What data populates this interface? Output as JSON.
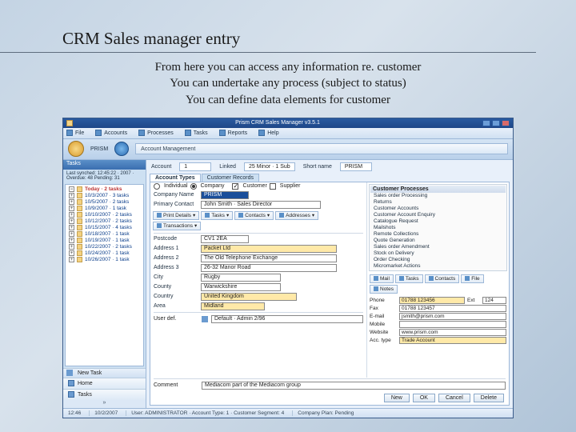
{
  "slide": {
    "title": "CRM Sales manager entry",
    "bullets": [
      "From here you can access any information re. customer",
      "You can undertake any process (subject to status)",
      "You can define data elements for customer"
    ]
  },
  "titlebar": "Prism CRM Sales Manager  v3.5.1",
  "menubar": [
    "File",
    "Accounts",
    "Processes",
    "Tasks",
    "Reports",
    "Help"
  ],
  "ribbon": {
    "brand": "PRISM",
    "crumb": "Account Management"
  },
  "sidebar": {
    "header": "Tasks",
    "subtitle": "Last synched: 12:45:22 · 2007  ·  Overdue: 48  Pending: 31",
    "root": "Today · 2 tasks",
    "dates": [
      "10/3/2007 · 3 tasks",
      "10/5/2007 · 2 tasks",
      "10/9/2007 · 1 task",
      "10/10/2007 · 2 tasks",
      "10/12/2007 · 2 tasks",
      "10/15/2007 · 4 tasks",
      "10/18/2007 · 1 task",
      "10/19/2007 · 1 task",
      "10/22/2007 · 2 tasks",
      "10/24/2007 · 1 task",
      "10/26/2007 · 1 task"
    ],
    "foot_label": "New Task",
    "nav": [
      "Home",
      "Tasks"
    ],
    "chev": "»"
  },
  "ids": {
    "acc_lab": "Account",
    "acc_val": "1",
    "linked_lab": "Linked",
    "linked_val": "25 Minor · 1 Sub",
    "short_lab": "Short name",
    "short_val": "PRISM"
  },
  "tabs": [
    "Account Types",
    "Customer Records"
  ],
  "types": {
    "individual_lab": "Individual",
    "company_lab": "Company",
    "customer_lab": "Customer",
    "supplier_lab": "Supplier",
    "contact_lab": "Primary Contact",
    "contact_val": "John Smith · Sales Director",
    "name_lab": "Company Name",
    "name_val": "PRISM"
  },
  "toolbar": [
    "Print Details",
    "Tasks",
    "Contacts",
    "Addresses",
    "Transactions"
  ],
  "toolbar_r": [
    "Mail",
    "Tasks",
    "Contacts",
    "File",
    "Notes"
  ],
  "details": {
    "postcode_lab": "Postcode",
    "postcode_val": "CV1 2EA",
    "addr1_lab": "Address 1",
    "addr1_val": "Packet Ltd",
    "addr2_lab": "Address 2",
    "addr2_val": "The Old Telephone Exchange",
    "addr3_lab": "Address 3",
    "addr3_val": "26-32 Manor Road",
    "city_lab": "City",
    "city_val": "Rugby",
    "county_lab": "County",
    "county_val": "Warwickshire",
    "country_lab": "Country",
    "country_val": "United Kingdom",
    "area_lab": "Area",
    "area_val": "Midland"
  },
  "proc": {
    "header": "Customer Processes",
    "items": [
      "Sales order Processing",
      "Returns",
      "Customer Accounts",
      "Customer Account Enquiry",
      "Catalogue Request",
      "Mailshots",
      "Remote Collections",
      "Quote Generation",
      "Sales order Amendment",
      "Stock on Delivery",
      "Order Checking",
      "Micromarket Actions"
    ]
  },
  "rfields": {
    "phone_lab": "Phone",
    "phone_val": "01788 123456",
    "ext_lab": "Ext",
    "ext_val": "124",
    "fax_lab": "Fax",
    "fax_val": "01788 123457",
    "email_lab": "E-mail",
    "email_val": "jsmith@prism.com",
    "mobile_lab": "Mobile",
    "mobile_val": "",
    "web_lab": "Website",
    "web_val": "www.prism.com",
    "acctype_lab": "Acc. type",
    "acctype_val": "Trade Account"
  },
  "userdef": {
    "lab": "User def.",
    "val": "Default · Admin 2/96"
  },
  "comment": {
    "lab": "Comment",
    "val": "Mediacom part of the Mediacom group"
  },
  "buttons": {
    "new": "New",
    "ok": "OK",
    "cancel": "Cancel",
    "del": "Delete"
  },
  "status": {
    "time": "12:46",
    "date": "10/2/2007",
    "user": "User: ADMINISTRATOR · Account Type: 1 · Customer Segment: 4",
    "tail": "Company Plan: Pending"
  }
}
